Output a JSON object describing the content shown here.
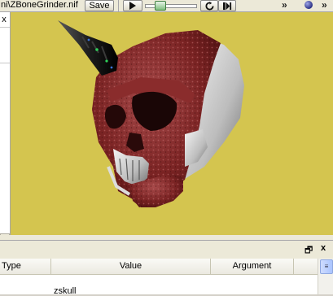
{
  "toolbar": {
    "filename": "ni\\ZBoneGrinder.nif",
    "save_label": "Save",
    "play_icon": "play-icon",
    "loop_icon": "loop-icon",
    "step_icon": "step-icon",
    "overflow_glyph": "»"
  },
  "left_panel": {
    "close_glyph": "x",
    "scroll_glyph": ">"
  },
  "viewport": {
    "background": "#d4c54f",
    "model": "skull with spike horn"
  },
  "bottom_panel": {
    "restore_glyph": "🗗",
    "close_glyph": "x",
    "columns": [
      "Type",
      "Value",
      "Argument"
    ],
    "rows": [
      {
        "type": "",
        "value": "zskull",
        "argument": ""
      }
    ]
  }
}
